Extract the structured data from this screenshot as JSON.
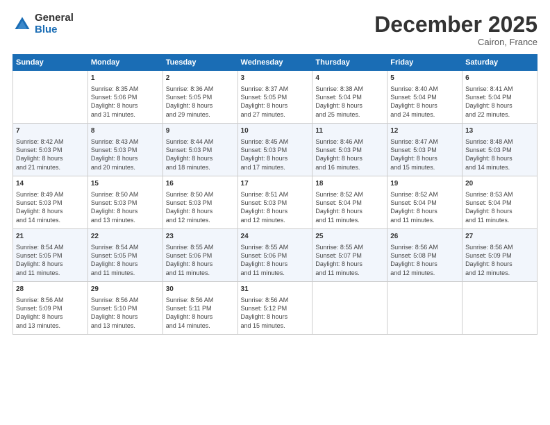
{
  "logo": {
    "general": "General",
    "blue": "Blue"
  },
  "title": "December 2025",
  "location": "Cairon, France",
  "days_header": [
    "Sunday",
    "Monday",
    "Tuesday",
    "Wednesday",
    "Thursday",
    "Friday",
    "Saturday"
  ],
  "weeks": [
    [
      {
        "day": "",
        "info": ""
      },
      {
        "day": "1",
        "info": "Sunrise: 8:35 AM\nSunset: 5:06 PM\nDaylight: 8 hours\nand 31 minutes."
      },
      {
        "day": "2",
        "info": "Sunrise: 8:36 AM\nSunset: 5:05 PM\nDaylight: 8 hours\nand 29 minutes."
      },
      {
        "day": "3",
        "info": "Sunrise: 8:37 AM\nSunset: 5:05 PM\nDaylight: 8 hours\nand 27 minutes."
      },
      {
        "day": "4",
        "info": "Sunrise: 8:38 AM\nSunset: 5:04 PM\nDaylight: 8 hours\nand 25 minutes."
      },
      {
        "day": "5",
        "info": "Sunrise: 8:40 AM\nSunset: 5:04 PM\nDaylight: 8 hours\nand 24 minutes."
      },
      {
        "day": "6",
        "info": "Sunrise: 8:41 AM\nSunset: 5:04 PM\nDaylight: 8 hours\nand 22 minutes."
      }
    ],
    [
      {
        "day": "7",
        "info": "Sunrise: 8:42 AM\nSunset: 5:03 PM\nDaylight: 8 hours\nand 21 minutes."
      },
      {
        "day": "8",
        "info": "Sunrise: 8:43 AM\nSunset: 5:03 PM\nDaylight: 8 hours\nand 20 minutes."
      },
      {
        "day": "9",
        "info": "Sunrise: 8:44 AM\nSunset: 5:03 PM\nDaylight: 8 hours\nand 18 minutes."
      },
      {
        "day": "10",
        "info": "Sunrise: 8:45 AM\nSunset: 5:03 PM\nDaylight: 8 hours\nand 17 minutes."
      },
      {
        "day": "11",
        "info": "Sunrise: 8:46 AM\nSunset: 5:03 PM\nDaylight: 8 hours\nand 16 minutes."
      },
      {
        "day": "12",
        "info": "Sunrise: 8:47 AM\nSunset: 5:03 PM\nDaylight: 8 hours\nand 15 minutes."
      },
      {
        "day": "13",
        "info": "Sunrise: 8:48 AM\nSunset: 5:03 PM\nDaylight: 8 hours\nand 14 minutes."
      }
    ],
    [
      {
        "day": "14",
        "info": "Sunrise: 8:49 AM\nSunset: 5:03 PM\nDaylight: 8 hours\nand 14 minutes."
      },
      {
        "day": "15",
        "info": "Sunrise: 8:50 AM\nSunset: 5:03 PM\nDaylight: 8 hours\nand 13 minutes."
      },
      {
        "day": "16",
        "info": "Sunrise: 8:50 AM\nSunset: 5:03 PM\nDaylight: 8 hours\nand 12 minutes."
      },
      {
        "day": "17",
        "info": "Sunrise: 8:51 AM\nSunset: 5:03 PM\nDaylight: 8 hours\nand 12 minutes."
      },
      {
        "day": "18",
        "info": "Sunrise: 8:52 AM\nSunset: 5:04 PM\nDaylight: 8 hours\nand 11 minutes."
      },
      {
        "day": "19",
        "info": "Sunrise: 8:52 AM\nSunset: 5:04 PM\nDaylight: 8 hours\nand 11 minutes."
      },
      {
        "day": "20",
        "info": "Sunrise: 8:53 AM\nSunset: 5:04 PM\nDaylight: 8 hours\nand 11 minutes."
      }
    ],
    [
      {
        "day": "21",
        "info": "Sunrise: 8:54 AM\nSunset: 5:05 PM\nDaylight: 8 hours\nand 11 minutes."
      },
      {
        "day": "22",
        "info": "Sunrise: 8:54 AM\nSunset: 5:05 PM\nDaylight: 8 hours\nand 11 minutes."
      },
      {
        "day": "23",
        "info": "Sunrise: 8:55 AM\nSunset: 5:06 PM\nDaylight: 8 hours\nand 11 minutes."
      },
      {
        "day": "24",
        "info": "Sunrise: 8:55 AM\nSunset: 5:06 PM\nDaylight: 8 hours\nand 11 minutes."
      },
      {
        "day": "25",
        "info": "Sunrise: 8:55 AM\nSunset: 5:07 PM\nDaylight: 8 hours\nand 11 minutes."
      },
      {
        "day": "26",
        "info": "Sunrise: 8:56 AM\nSunset: 5:08 PM\nDaylight: 8 hours\nand 12 minutes."
      },
      {
        "day": "27",
        "info": "Sunrise: 8:56 AM\nSunset: 5:09 PM\nDaylight: 8 hours\nand 12 minutes."
      }
    ],
    [
      {
        "day": "28",
        "info": "Sunrise: 8:56 AM\nSunset: 5:09 PM\nDaylight: 8 hours\nand 13 minutes."
      },
      {
        "day": "29",
        "info": "Sunrise: 8:56 AM\nSunset: 5:10 PM\nDaylight: 8 hours\nand 13 minutes."
      },
      {
        "day": "30",
        "info": "Sunrise: 8:56 AM\nSunset: 5:11 PM\nDaylight: 8 hours\nand 14 minutes."
      },
      {
        "day": "31",
        "info": "Sunrise: 8:56 AM\nSunset: 5:12 PM\nDaylight: 8 hours\nand 15 minutes."
      },
      {
        "day": "",
        "info": ""
      },
      {
        "day": "",
        "info": ""
      },
      {
        "day": "",
        "info": ""
      }
    ]
  ]
}
